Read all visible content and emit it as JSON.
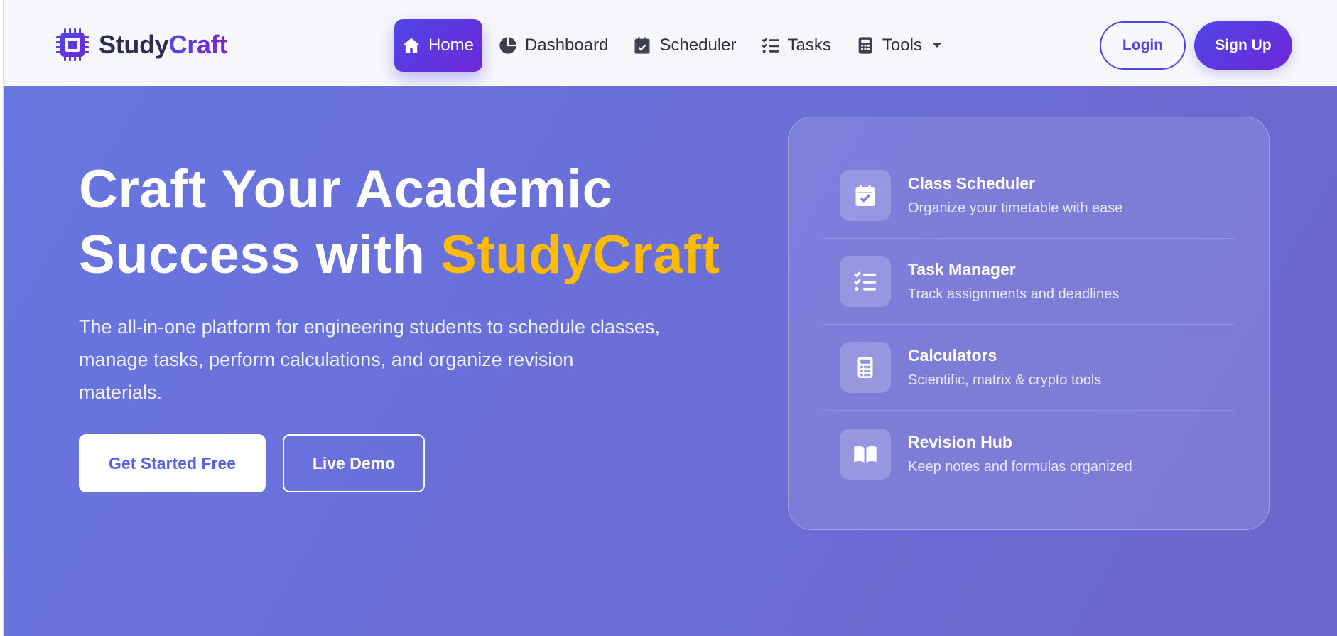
{
  "brand": {
    "name_part1": "Study",
    "name_part2": "Craft",
    "logo_icon": "chip-icon"
  },
  "nav": {
    "items": [
      {
        "label": "Home",
        "icon": "home-icon",
        "active": true
      },
      {
        "label": "Dashboard",
        "icon": "pie-chart-icon",
        "active": false
      },
      {
        "label": "Scheduler",
        "icon": "calendar-check-icon",
        "active": false
      },
      {
        "label": "Tasks",
        "icon": "list-check-icon",
        "active": false
      },
      {
        "label": "Tools",
        "icon": "calculator-icon",
        "active": false,
        "has_dropdown": true
      }
    ]
  },
  "auth": {
    "login_label": "Login",
    "signup_label": "Sign Up"
  },
  "hero": {
    "title_line1": "Craft Your Academic",
    "title_line2_prefix": "Success with ",
    "title_accent": "StudyCraft",
    "subtitle": "The all-in-one platform for engineering students to schedule classes, manage tasks, perform calculations, and organize revision materials.",
    "primary_cta": "Get Started Free",
    "secondary_cta": "Live Demo"
  },
  "features": [
    {
      "title": "Class Scheduler",
      "desc": "Organize your timetable with ease",
      "icon": "calendar-check-icon"
    },
    {
      "title": "Task Manager",
      "desc": "Track assignments and deadlines",
      "icon": "list-check-icon"
    },
    {
      "title": "Calculators",
      "desc": "Scientific, matrix & crypto tools",
      "icon": "calculator-icon"
    },
    {
      "title": "Revision Hub",
      "desc": "Keep notes and formulas organized",
      "icon": "book-open-icon"
    }
  ],
  "colors": {
    "brand_primary": "#4f46e5",
    "brand_secondary": "#6d28d9",
    "accent_yellow": "#ffbb00",
    "hero_bg": "#6b6fd8"
  }
}
